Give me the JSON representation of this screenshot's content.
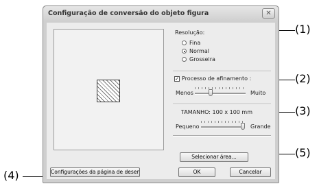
{
  "dialog": {
    "title": "Configuração de conversão do objeto figura",
    "close_glyph": "✕"
  },
  "resolution": {
    "label": "Resolução:",
    "options": [
      {
        "label": "Fina",
        "selected": false
      },
      {
        "label": "Normal",
        "selected": true
      },
      {
        "label": "Grosseira",
        "selected": false
      }
    ]
  },
  "refinement": {
    "checkbox_label": "Processo de afinamento :",
    "checked": true,
    "check_glyph": "✓",
    "min_label": "Menos",
    "max_label": "Muito",
    "level": 0.3
  },
  "size": {
    "text": "TAMANHO:  100 x 100 mm",
    "min_label": "Pequeno",
    "max_label": "Grande",
    "level": 1.0
  },
  "buttons": {
    "select_area": "Selecionar área...",
    "page_settings": "Configurações da página de desenho...",
    "ok": "OK",
    "cancel": "Cancelar"
  },
  "callouts": {
    "c1": "(1)",
    "c2": "(2)",
    "c3": "(3)",
    "c4": "(4)",
    "c5": "(5)"
  },
  "icons": {
    "close": "close-icon",
    "preview": "hatched-square-icon"
  }
}
